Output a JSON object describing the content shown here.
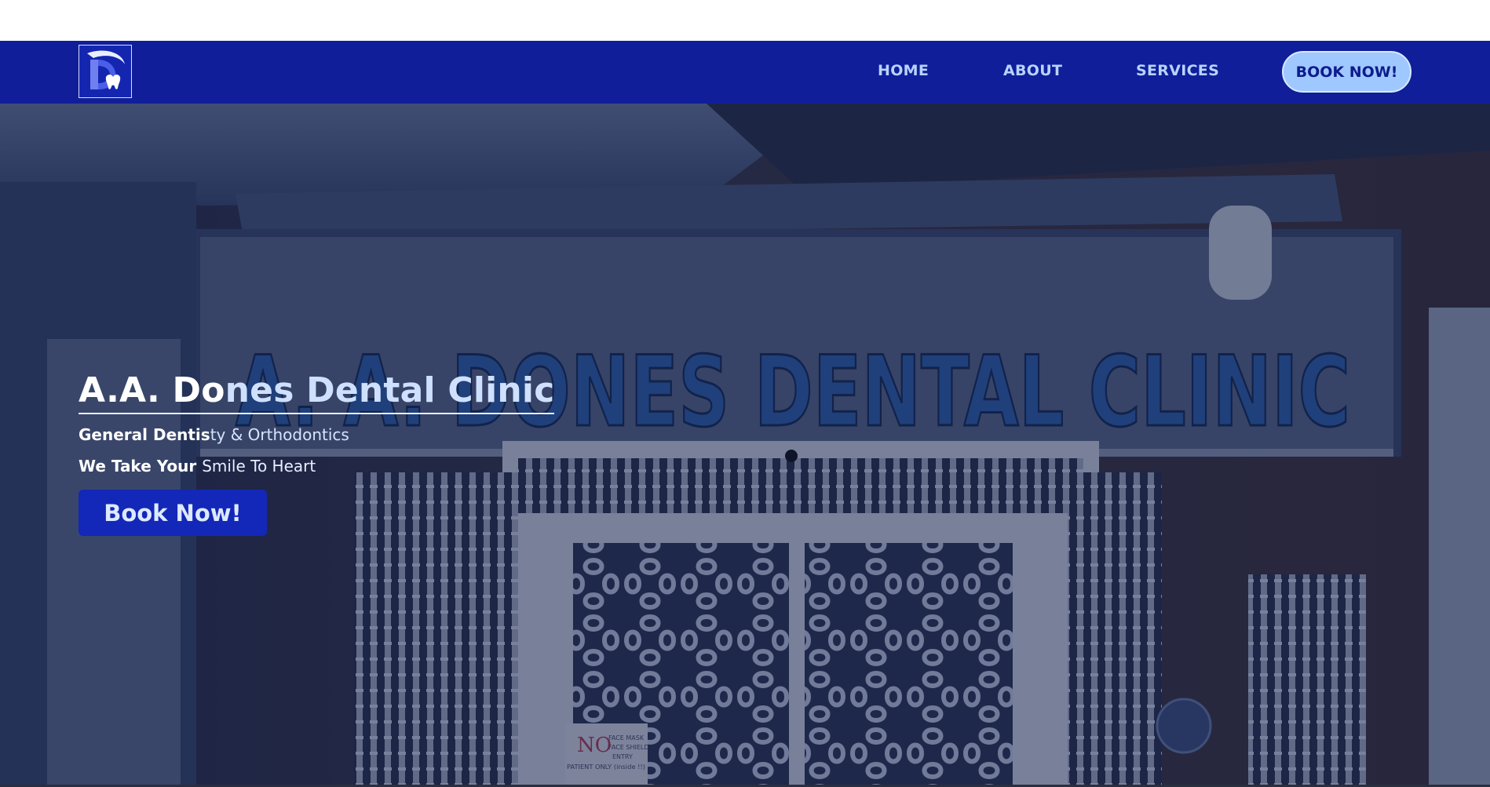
{
  "nav": {
    "logo_icon": "clinic-logo-icon",
    "links": [
      "HOME",
      "ABOUT",
      "SERVICES"
    ],
    "book_label": "BOOK NOW!"
  },
  "hero": {
    "sign_text": "A. A. DONES DENTAL CLINIC",
    "title_part1": "A.A. Do",
    "title_part2": "nes Dental Clinic",
    "subtitle_part1": "General Dentis",
    "subtitle_part2": "ty & Orthodontics",
    "tagline_part1": "We Take Your ",
    "tagline_part2": "Smile To Heart",
    "cta_label": "Book Now!",
    "notice_sign": {
      "no": "NO",
      "line1": "FACE MASK",
      "line2": "FACE SHIELD",
      "line3": "ENTRY",
      "line4": "PATIENT ONLY (inside !!)"
    }
  },
  "colors": {
    "nav_bg": "#101e9a",
    "nav_link": "#b9d3ff",
    "book_button_bg": "#9ec8ff",
    "hero_button_bg": "#1327b8"
  }
}
